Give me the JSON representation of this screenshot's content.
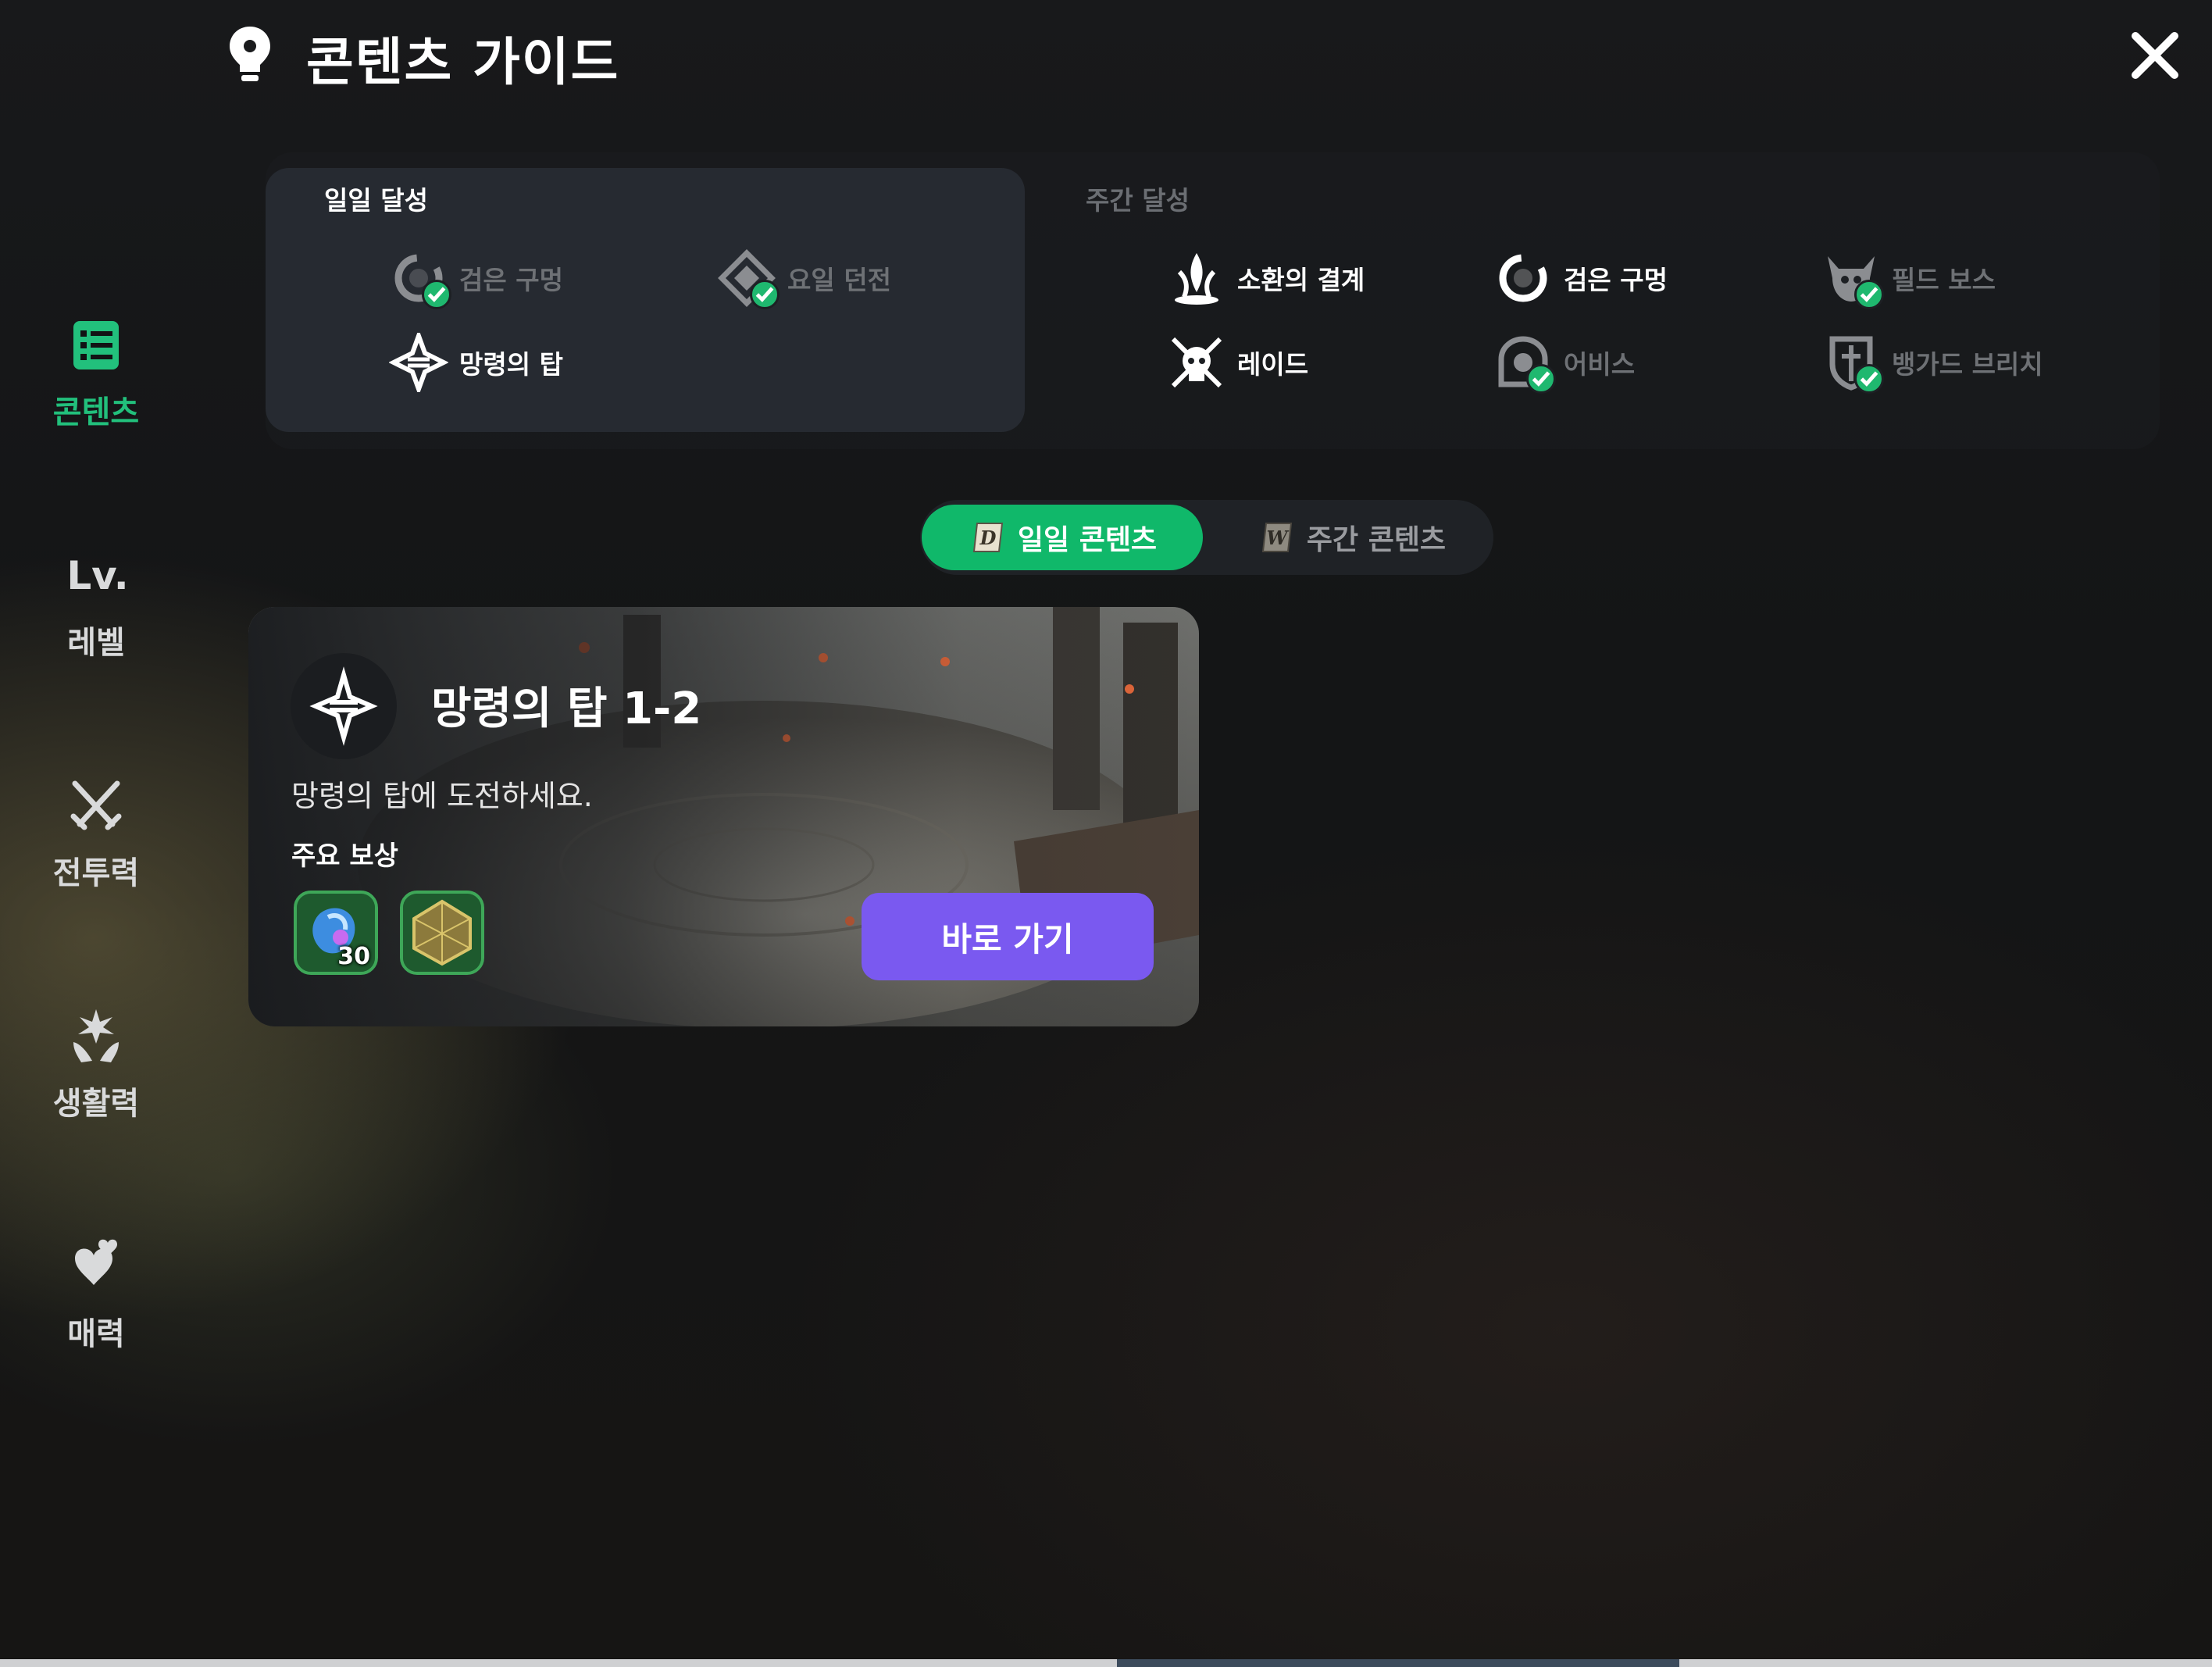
{
  "header": {
    "title": "콘텐츠 가이드",
    "icon": "lightbulb-icon",
    "close_icon": "close-icon"
  },
  "sidebar": {
    "items": [
      {
        "label": "콘텐츠",
        "icon": "checklist-icon",
        "active": true
      },
      {
        "label": "레벨",
        "icon": "level-icon",
        "icon_text": "Lv."
      },
      {
        "label": "전투력",
        "icon": "crossed-swords-icon"
      },
      {
        "label": "생활력",
        "icon": "sparkle-hands-icon"
      },
      {
        "label": "매력",
        "icon": "hearts-icon"
      }
    ]
  },
  "achievements": {
    "daily": {
      "title": "일일 달성",
      "items": [
        {
          "label": "검은 구멍",
          "icon": "black-hole-icon",
          "completed": true
        },
        {
          "label": "요일 던전",
          "icon": "dungeon-icon",
          "completed": true
        },
        {
          "label": "망령의 탑",
          "icon": "wraith-tower-icon",
          "completed": false
        }
      ]
    },
    "weekly": {
      "title": "주간 달성",
      "items": [
        {
          "label": "소환의 결계",
          "icon": "summon-barrier-icon",
          "completed": false
        },
        {
          "label": "검은 구멍",
          "icon": "black-hole-icon",
          "completed": false
        },
        {
          "label": "필드 보스",
          "icon": "field-boss-icon",
          "completed": true
        },
        {
          "label": "레이드",
          "icon": "raid-skull-icon",
          "completed": false
        },
        {
          "label": "어비스",
          "icon": "abyss-icon",
          "completed": true
        },
        {
          "label": "뱅가드 브리치",
          "icon": "vanguard-breach-icon",
          "completed": true
        }
      ]
    }
  },
  "tabs": [
    {
      "label": "일일 콘텐츠",
      "badge": "D",
      "selected": true
    },
    {
      "label": "주간 콘텐츠",
      "badge": "W",
      "selected": false
    }
  ],
  "card": {
    "title": "망령의 탑 1-2",
    "description": "망령의 탑에 도전하세요.",
    "reward_label": "주요 보상",
    "rewards": [
      {
        "icon": "blue-crystal-icon",
        "quantity": "30"
      },
      {
        "icon": "green-die-icon",
        "quantity": ""
      }
    ],
    "go_button": "바로 가기"
  },
  "colors": {
    "accent_green": "#10b86a",
    "active_sidebar": "#22c07c",
    "go_button": "#7a59f0",
    "completed_check": "#1fb86f"
  }
}
